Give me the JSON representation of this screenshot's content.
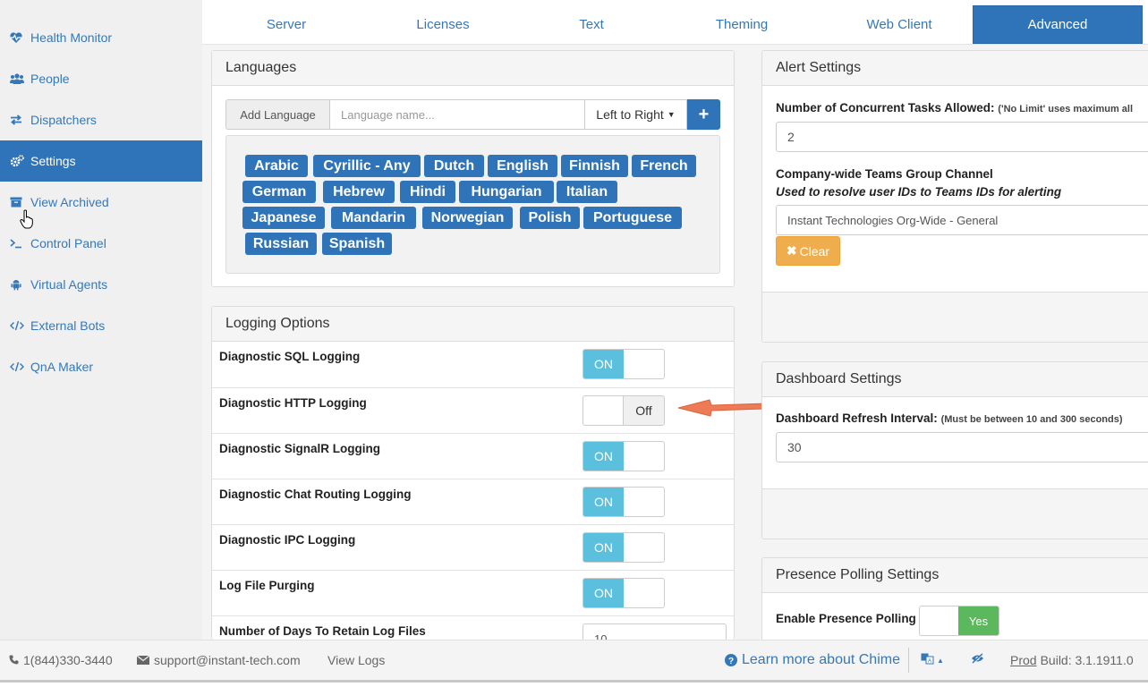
{
  "sidebar": {
    "items": [
      {
        "label": "Health Monitor",
        "icon": "heartbeat-icon"
      },
      {
        "label": "People",
        "icon": "users-icon"
      },
      {
        "label": "Dispatchers",
        "icon": "exchange-icon"
      },
      {
        "label": "Settings",
        "icon": "cogs-icon",
        "active": true
      },
      {
        "label": "View Archived",
        "icon": "archive-icon"
      },
      {
        "label": "Control Panel",
        "icon": "terminal-icon"
      },
      {
        "label": "Virtual Agents",
        "icon": "android-icon"
      },
      {
        "label": "External Bots",
        "icon": "code-icon"
      },
      {
        "label": "QnA Maker",
        "icon": "code-icon"
      }
    ]
  },
  "tabs": [
    {
      "label": "Server"
    },
    {
      "label": "Licenses"
    },
    {
      "label": "Text"
    },
    {
      "label": "Theming"
    },
    {
      "label": "Web Client"
    },
    {
      "label": "Advanced",
      "active": true
    }
  ],
  "languages": {
    "title": "Languages",
    "add_label": "Add Language",
    "placeholder": "Language name...",
    "direction": "Left to Right",
    "add_button": "+",
    "tags": [
      "Arabic",
      "Cyrillic - Any",
      "Dutch",
      "English",
      "Finnish",
      "French",
      "German",
      "Hebrew",
      "Hindi",
      "Hungarian",
      "Italian",
      "Japanese",
      "Mandarin",
      "Norwegian",
      "Polish",
      "Portuguese",
      "Russian",
      "Spanish"
    ]
  },
  "logging": {
    "title": "Logging Options",
    "rows": [
      {
        "label": "Diagnostic SQL Logging",
        "state": "ON"
      },
      {
        "label": "Diagnostic HTTP Logging",
        "state": "Off"
      },
      {
        "label": "Diagnostic SignalR Logging",
        "state": "ON"
      },
      {
        "label": "Diagnostic Chat Routing Logging",
        "state": "ON"
      },
      {
        "label": "Diagnostic IPC Logging",
        "state": "ON"
      },
      {
        "label": "Log File Purging",
        "state": "ON"
      },
      {
        "label": "Number of Days To Retain Log Files",
        "value": "10"
      }
    ]
  },
  "alert": {
    "title": "Alert Settings",
    "concurrent_label": "Number of Concurrent Tasks Allowed:",
    "concurrent_hint": "('No Limit' uses maximum all",
    "concurrent_value": "2",
    "teams_label": "Company-wide Teams Group Channel",
    "teams_sub": "Used to resolve user IDs to Teams IDs for alerting",
    "teams_value": "Instant Technologies Org-Wide - General",
    "clear_label": "Clear"
  },
  "dashboard": {
    "title": "Dashboard Settings",
    "refresh_label": "Dashboard Refresh Interval:",
    "refresh_hint": "(Must be between 10 and 300 seconds)",
    "refresh_value": "30"
  },
  "presence": {
    "title": "Presence Polling Settings",
    "enable_label": "Enable Presence Polling",
    "enable_state": "Yes"
  },
  "footer": {
    "phone": "1(844)330-3440",
    "email": "support@instant-tech.com",
    "view_logs": "View Logs",
    "learn_more": "Learn more about Chime",
    "env": "Prod",
    "build": "Build: 3.1.1911.0"
  },
  "colors": {
    "primary": "#2f74b8",
    "info": "#5bc0de",
    "success": "#5cb85c",
    "warning": "#f0ad4e",
    "arrow": "#ee7b56"
  }
}
